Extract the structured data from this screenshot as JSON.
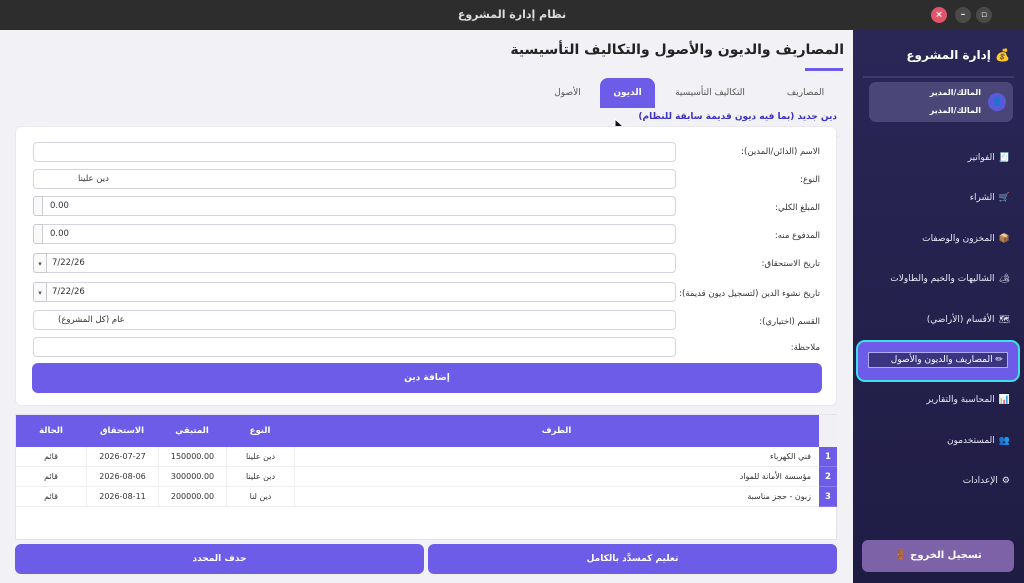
{
  "window": {
    "title": "نظام إدارة المشروع"
  },
  "sidebar": {
    "title": "💰 إدارة المشروع",
    "user_line1": "المالك/المدير",
    "user_line2": "المالك/المدير",
    "items": [
      {
        "icon": "🧾",
        "label": "الفواتير"
      },
      {
        "icon": "🛒",
        "label": "الشراء"
      },
      {
        "icon": "📦",
        "label": "المخزون والوصفات"
      },
      {
        "icon": "🏕",
        "label": "الشاليهات والخيم والطاولات"
      },
      {
        "icon": "🗺",
        "label": "الأقسام (الأراضي)"
      },
      {
        "icon": "✏",
        "label": "المصاريف والديون والأصول"
      },
      {
        "icon": "📊",
        "label": "المحاسبة والتقارير"
      },
      {
        "icon": "👥",
        "label": "المستخدمون"
      },
      {
        "icon": "⚙",
        "label": "الإعدادات"
      }
    ],
    "logout": "تسجيل الخروج 🚪"
  },
  "page": {
    "title": "المصاريف والديون والأصول والتكاليف التأسيسية"
  },
  "tabs": [
    "المصاريف",
    "التكاليف التأسيسية",
    "الديون",
    "الأصول"
  ],
  "form": {
    "section_title": "دين جديد (بما فيه ديون قديمة سابقة للنظام)",
    "labels": {
      "name": "الاسم (الدائن/المدين):",
      "type": "النوع:",
      "total": "المبلغ الكلي:",
      "paid": "المدفوع منه:",
      "due": "تاريخ الاستحقاق:",
      "origin": "تاريخ نشوء الدين (لتسجيل ديون قديمة):",
      "section": "القسم (اختياري):",
      "note": "ملاحظة:"
    },
    "values": {
      "name": "",
      "type": "دين علينا",
      "total": "0.00",
      "paid": "0.00",
      "due": "7/22/26",
      "origin": "7/22/26",
      "section": "عام (كل المشروع)",
      "note": ""
    },
    "add_button": "إضافة دين"
  },
  "table": {
    "headers": {
      "party": "الطرف",
      "type": "النوع",
      "remaining": "المتبقي",
      "due": "الاستحقاق",
      "status": "الحالة"
    },
    "rows": [
      {
        "num": "1",
        "party": "فني الكهرباء",
        "type": "دين علينا",
        "remaining": "150000.00",
        "due": "2026-07-27",
        "status": "قائم"
      },
      {
        "num": "2",
        "party": "مؤسسة الأمانة للمواد",
        "type": "دين علينا",
        "remaining": "300000.00",
        "due": "2026-08-06",
        "status": "قائم"
      },
      {
        "num": "3",
        "party": "زبون - حجز مناسبة",
        "type": "دين لنا",
        "remaining": "200000.00",
        "due": "2026-08-11",
        "status": "قائم"
      }
    ]
  },
  "buttons": {
    "mark_paid": "تعليم كمسدَّد بالكامل",
    "delete": "حذف المحدد"
  },
  "colors": {
    "accent": "#6c5ce7",
    "sidebar": "#2a2656",
    "highlight": "#3ee0e6"
  }
}
